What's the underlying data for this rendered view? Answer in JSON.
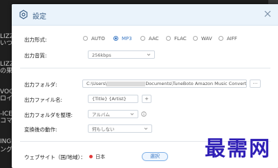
{
  "background": {
    "left_texts": [
      "LIZZA",
      "いつか",
      "LIZZAR",
      "の果ての",
      "VOCAL",
      "ロイ",
      "-ICE",
      "コマン",
      "INGLE",
      "ング"
    ]
  },
  "dialog": {
    "title": "設定",
    "output_format": {
      "label": "出力形式:",
      "options": [
        "AUTO",
        "MP3",
        "AAC",
        "FLAC",
        "WAV",
        "AIFF"
      ],
      "selected": "MP3"
    },
    "output_quality": {
      "label": "出力音質:",
      "value": "256kbps"
    },
    "output_folder": {
      "label": "出力フォルダ:",
      "path_prefix": "C:\\Users\\",
      "path_suffix": "Documents\\TuneBoto Amazon Music Converter",
      "browse_label": "···"
    },
    "output_filename": {
      "label": "出力ファイル名:",
      "value": "{Title} {Artist}",
      "add_label": "+"
    },
    "organize_folder": {
      "label": "出力フォルダを整理:",
      "value": "アルバム"
    },
    "after_convert": {
      "label": "変換後の動作:",
      "value": "何もしない"
    },
    "website": {
      "label": "ウェブサイト（国/地域）：",
      "country": "日本",
      "select_label": "選択"
    }
  },
  "watermark": "最需网",
  "colors": {
    "accent": "#3b78c4",
    "titlebar": "#eaf3fb",
    "watermark": "#2f1fb6"
  }
}
